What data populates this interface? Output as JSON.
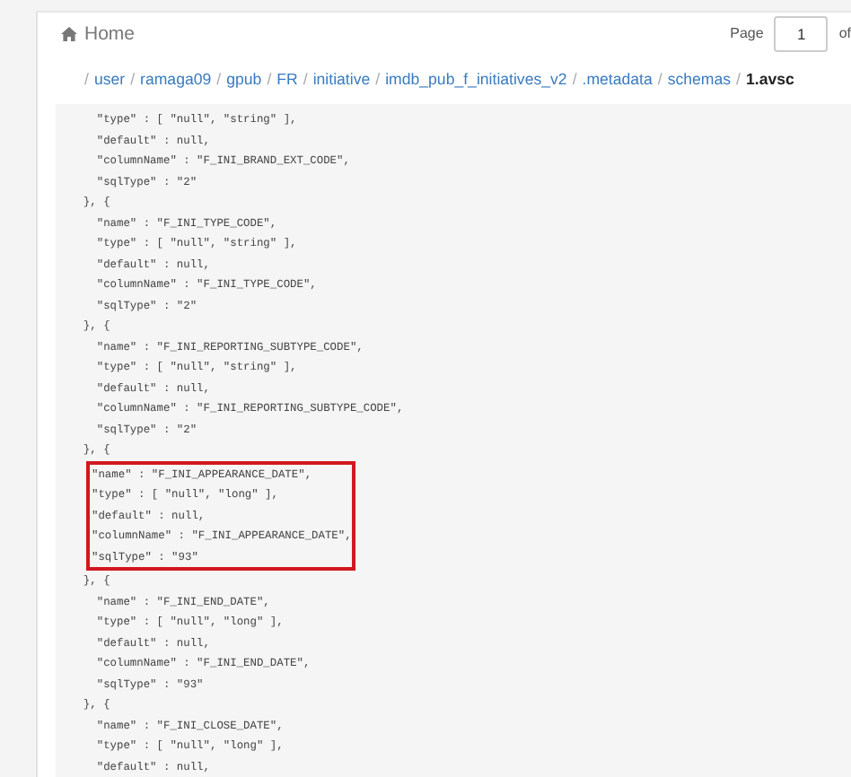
{
  "header": {
    "home_label": "Home",
    "page_label": "Page",
    "page_value": "1",
    "page_of": "of"
  },
  "breadcrumb": {
    "separator": "/",
    "items": [
      "user",
      "ramaga09",
      "gpub",
      "FR",
      "initiative",
      "imdb_pub_f_initiatives_v2",
      ".metadata",
      "schemas",
      "1.avsc"
    ]
  },
  "code_blocks": [
    {
      "highlighted": false,
      "lines": [
        "    \"type\" : [ \"null\", \"string\" ],",
        "    \"default\" : null,",
        "    \"columnName\" : \"F_INI_BRAND_EXT_CODE\",",
        "    \"sqlType\" : \"2\"",
        "  }, {",
        "    \"name\" : \"F_INI_TYPE_CODE\",",
        "    \"type\" : [ \"null\", \"string\" ],",
        "    \"default\" : null,",
        "    \"columnName\" : \"F_INI_TYPE_CODE\",",
        "    \"sqlType\" : \"2\"",
        "  }, {",
        "    \"name\" : \"F_INI_REPORTING_SUBTYPE_CODE\",",
        "    \"type\" : [ \"null\", \"string\" ],",
        "    \"default\" : null,",
        "    \"columnName\" : \"F_INI_REPORTING_SUBTYPE_CODE\",",
        "    \"sqlType\" : \"2\"",
        "  }, {"
      ]
    },
    {
      "highlighted": true,
      "lines": [
        "\"name\" : \"F_INI_APPEARANCE_DATE\",",
        "\"type\" : [ \"null\", \"long\" ],",
        "\"default\" : null,",
        "\"columnName\" : \"F_INI_APPEARANCE_DATE\",",
        "\"sqlType\" : \"93\""
      ]
    },
    {
      "highlighted": false,
      "lines": [
        "  }, {",
        "    \"name\" : \"F_INI_END_DATE\",",
        "    \"type\" : [ \"null\", \"long\" ],",
        "    \"default\" : null,",
        "    \"columnName\" : \"F_INI_END_DATE\",",
        "    \"sqlType\" : \"93\"",
        "  }, {",
        "    \"name\" : \"F_INI_CLOSE_DATE\",",
        "    \"type\" : [ \"null\", \"long\" ],",
        "    \"default\" : null,"
      ]
    }
  ]
}
